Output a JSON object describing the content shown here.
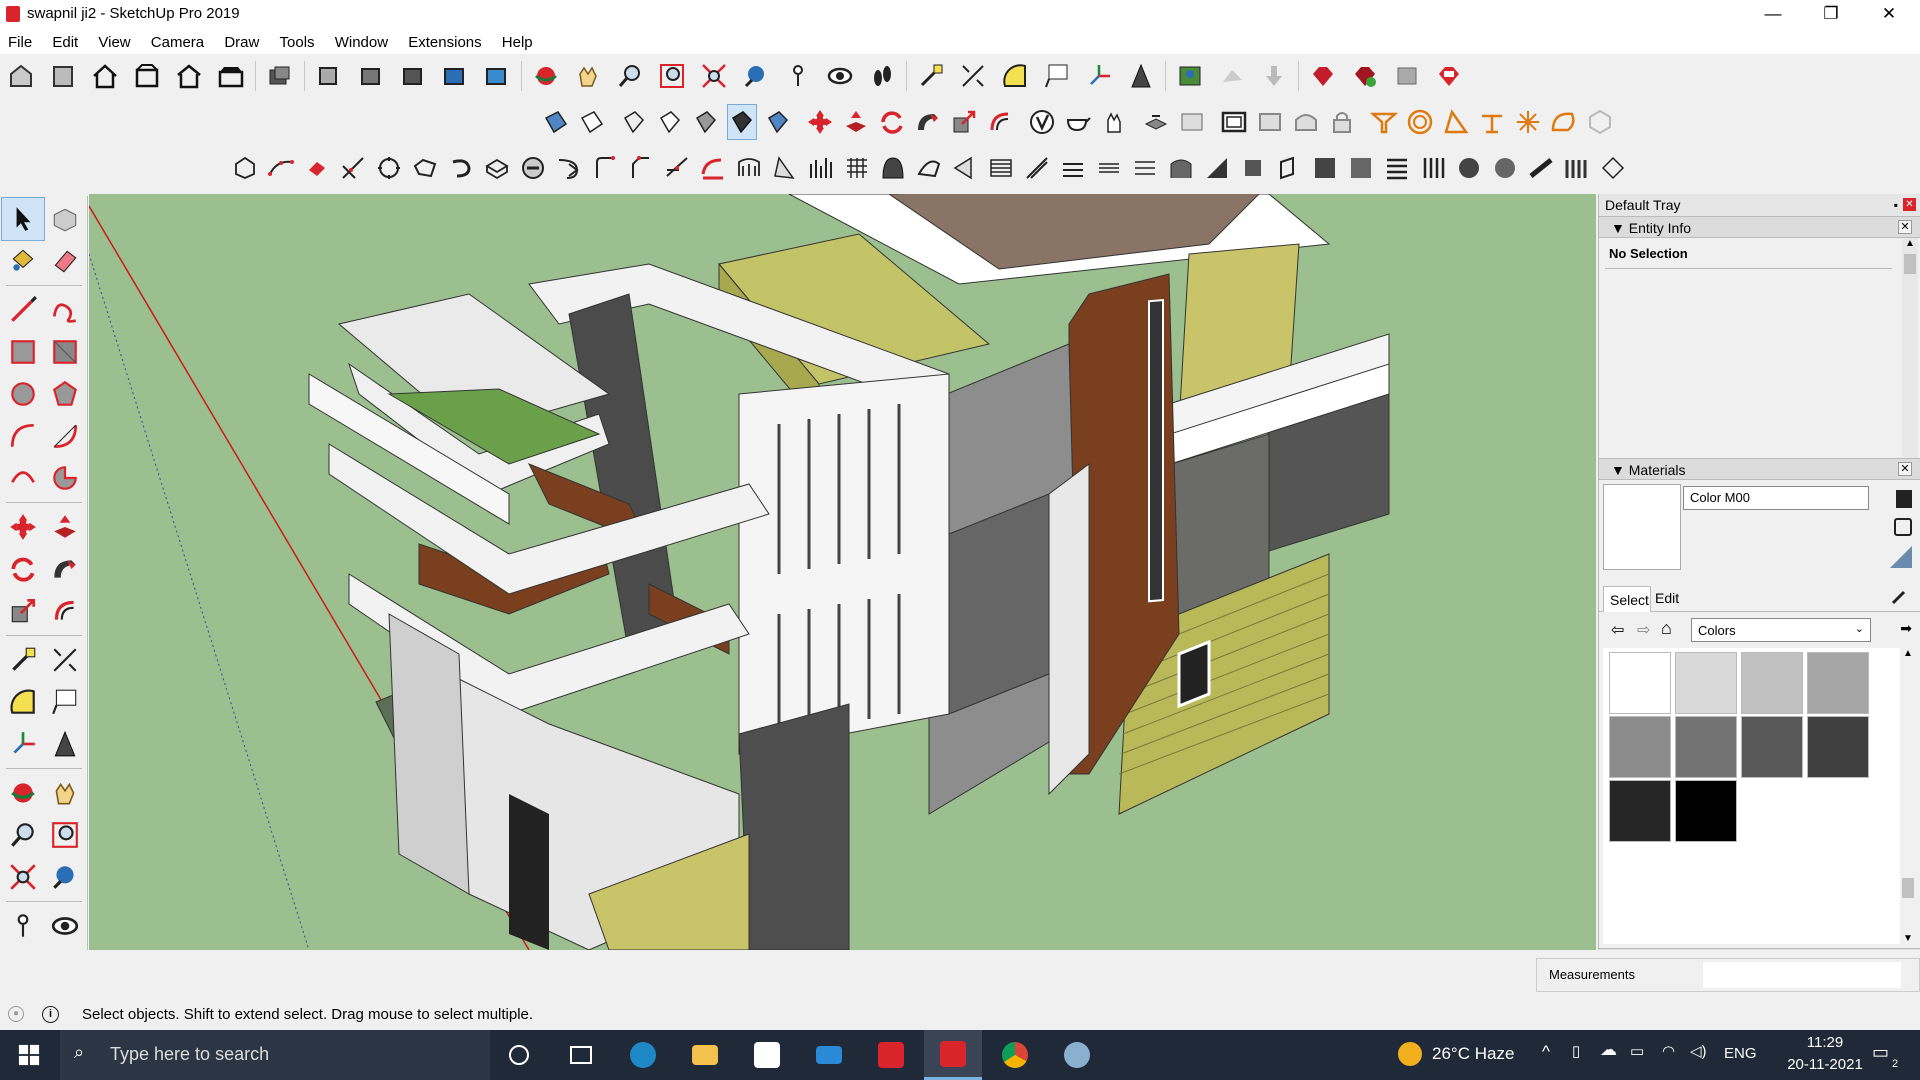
{
  "window": {
    "title": "swapnil ji2 - SketchUp Pro 2019",
    "minimize": "—",
    "restore": "❐",
    "close": "✕"
  },
  "menu": [
    "File",
    "Edit",
    "View",
    "Camera",
    "Draw",
    "Tools",
    "Window",
    "Extensions",
    "Help"
  ],
  "tray": {
    "title": "Default Tray",
    "entity_info": {
      "label": "Entity Info",
      "selection": "No Selection"
    },
    "materials": {
      "label": "Materials",
      "current_name": "Color M00",
      "tab_select": "Select",
      "tab_edit": "Edit",
      "library": "Colors",
      "swatch_colors": [
        "#ffffff",
        "#d9d9d9",
        "#c0c0c0",
        "#a6a6a6",
        "#8c8c8c",
        "#737373",
        "#595959",
        "#404040",
        "#262626",
        "#000000"
      ]
    }
  },
  "status": {
    "message": "Select objects. Shift to extend select. Drag mouse to select multiple.",
    "measurements_label": "Measurements",
    "measurements_value": ""
  },
  "taskbar": {
    "search_placeholder": "Type here to search",
    "weather": "26°C  Haze",
    "language": "ENG",
    "time": "11:29",
    "date": "20-11-2021",
    "notifications": "2"
  },
  "colors": {
    "sky_ground": "#9cbf8f",
    "taskbar": "#1f2937",
    "accent_red": "#d9242b"
  }
}
